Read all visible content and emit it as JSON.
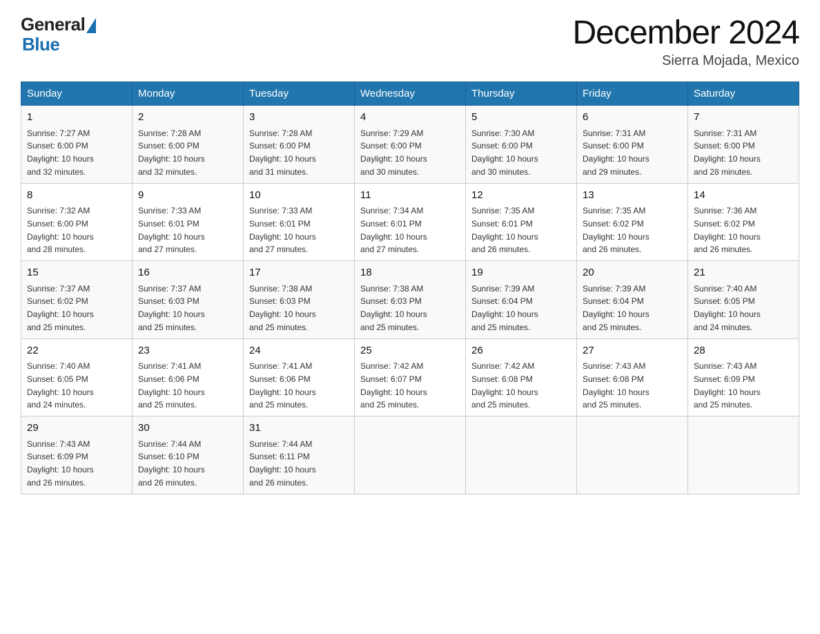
{
  "header": {
    "logo_general": "General",
    "logo_blue": "Blue",
    "month_title": "December 2024",
    "location": "Sierra Mojada, Mexico"
  },
  "days_of_week": [
    "Sunday",
    "Monday",
    "Tuesday",
    "Wednesday",
    "Thursday",
    "Friday",
    "Saturday"
  ],
  "weeks": [
    [
      {
        "num": "1",
        "sunrise": "7:27 AM",
        "sunset": "6:00 PM",
        "daylight": "10 hours and 32 minutes."
      },
      {
        "num": "2",
        "sunrise": "7:28 AM",
        "sunset": "6:00 PM",
        "daylight": "10 hours and 32 minutes."
      },
      {
        "num": "3",
        "sunrise": "7:28 AM",
        "sunset": "6:00 PM",
        "daylight": "10 hours and 31 minutes."
      },
      {
        "num": "4",
        "sunrise": "7:29 AM",
        "sunset": "6:00 PM",
        "daylight": "10 hours and 30 minutes."
      },
      {
        "num": "5",
        "sunrise": "7:30 AM",
        "sunset": "6:00 PM",
        "daylight": "10 hours and 30 minutes."
      },
      {
        "num": "6",
        "sunrise": "7:31 AM",
        "sunset": "6:00 PM",
        "daylight": "10 hours and 29 minutes."
      },
      {
        "num": "7",
        "sunrise": "7:31 AM",
        "sunset": "6:00 PM",
        "daylight": "10 hours and 28 minutes."
      }
    ],
    [
      {
        "num": "8",
        "sunrise": "7:32 AM",
        "sunset": "6:00 PM",
        "daylight": "10 hours and 28 minutes."
      },
      {
        "num": "9",
        "sunrise": "7:33 AM",
        "sunset": "6:01 PM",
        "daylight": "10 hours and 27 minutes."
      },
      {
        "num": "10",
        "sunrise": "7:33 AM",
        "sunset": "6:01 PM",
        "daylight": "10 hours and 27 minutes."
      },
      {
        "num": "11",
        "sunrise": "7:34 AM",
        "sunset": "6:01 PM",
        "daylight": "10 hours and 27 minutes."
      },
      {
        "num": "12",
        "sunrise": "7:35 AM",
        "sunset": "6:01 PM",
        "daylight": "10 hours and 26 minutes."
      },
      {
        "num": "13",
        "sunrise": "7:35 AM",
        "sunset": "6:02 PM",
        "daylight": "10 hours and 26 minutes."
      },
      {
        "num": "14",
        "sunrise": "7:36 AM",
        "sunset": "6:02 PM",
        "daylight": "10 hours and 26 minutes."
      }
    ],
    [
      {
        "num": "15",
        "sunrise": "7:37 AM",
        "sunset": "6:02 PM",
        "daylight": "10 hours and 25 minutes."
      },
      {
        "num": "16",
        "sunrise": "7:37 AM",
        "sunset": "6:03 PM",
        "daylight": "10 hours and 25 minutes."
      },
      {
        "num": "17",
        "sunrise": "7:38 AM",
        "sunset": "6:03 PM",
        "daylight": "10 hours and 25 minutes."
      },
      {
        "num": "18",
        "sunrise": "7:38 AM",
        "sunset": "6:03 PM",
        "daylight": "10 hours and 25 minutes."
      },
      {
        "num": "19",
        "sunrise": "7:39 AM",
        "sunset": "6:04 PM",
        "daylight": "10 hours and 25 minutes."
      },
      {
        "num": "20",
        "sunrise": "7:39 AM",
        "sunset": "6:04 PM",
        "daylight": "10 hours and 25 minutes."
      },
      {
        "num": "21",
        "sunrise": "7:40 AM",
        "sunset": "6:05 PM",
        "daylight": "10 hours and 24 minutes."
      }
    ],
    [
      {
        "num": "22",
        "sunrise": "7:40 AM",
        "sunset": "6:05 PM",
        "daylight": "10 hours and 24 minutes."
      },
      {
        "num": "23",
        "sunrise": "7:41 AM",
        "sunset": "6:06 PM",
        "daylight": "10 hours and 25 minutes."
      },
      {
        "num": "24",
        "sunrise": "7:41 AM",
        "sunset": "6:06 PM",
        "daylight": "10 hours and 25 minutes."
      },
      {
        "num": "25",
        "sunrise": "7:42 AM",
        "sunset": "6:07 PM",
        "daylight": "10 hours and 25 minutes."
      },
      {
        "num": "26",
        "sunrise": "7:42 AM",
        "sunset": "6:08 PM",
        "daylight": "10 hours and 25 minutes."
      },
      {
        "num": "27",
        "sunrise": "7:43 AM",
        "sunset": "6:08 PM",
        "daylight": "10 hours and 25 minutes."
      },
      {
        "num": "28",
        "sunrise": "7:43 AM",
        "sunset": "6:09 PM",
        "daylight": "10 hours and 25 minutes."
      }
    ],
    [
      {
        "num": "29",
        "sunrise": "7:43 AM",
        "sunset": "6:09 PM",
        "daylight": "10 hours and 26 minutes."
      },
      {
        "num": "30",
        "sunrise": "7:44 AM",
        "sunset": "6:10 PM",
        "daylight": "10 hours and 26 minutes."
      },
      {
        "num": "31",
        "sunrise": "7:44 AM",
        "sunset": "6:11 PM",
        "daylight": "10 hours and 26 minutes."
      },
      null,
      null,
      null,
      null
    ]
  ],
  "labels": {
    "sunrise": "Sunrise:",
    "sunset": "Sunset:",
    "daylight": "Daylight:"
  }
}
